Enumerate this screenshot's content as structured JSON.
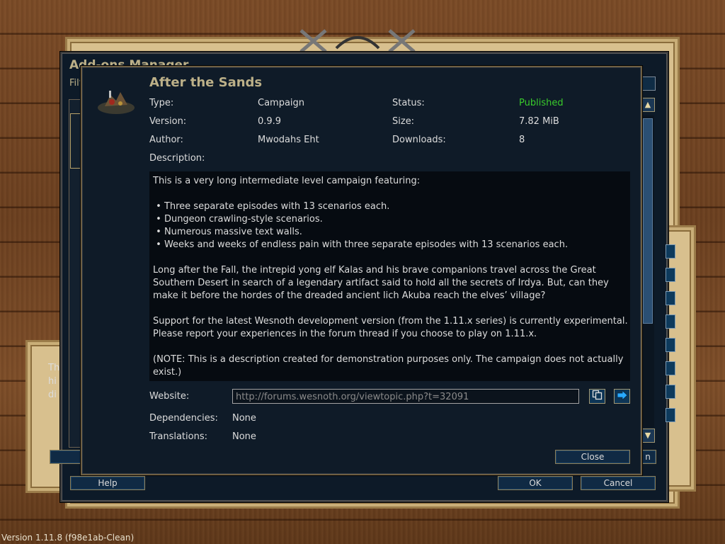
{
  "outer_dialog": {
    "title": "Add-ons Manager",
    "filter_label": "Filt",
    "side_text": "Th\nhi\ndi",
    "buttons": {
      "help": "Help",
      "ok": "OK",
      "cancel": "Cancel"
    },
    "side_button_fragment": "n"
  },
  "addon": {
    "title": "After the Sands",
    "fields": [
      {
        "label": "Type:",
        "value": "Campaign"
      },
      {
        "label": "Version:",
        "value": "0.9.9"
      },
      {
        "label": "Author:",
        "value": "Mwodahs Eht"
      }
    ],
    "fields_right": [
      {
        "label": "Status:",
        "value": "Published"
      },
      {
        "label": "Size:",
        "value": "7.82 MiB"
      },
      {
        "label": "Downloads:",
        "value": "8"
      }
    ],
    "description_label": "Description:",
    "description": "This is a very long intermediate level campaign featuring:\n\n • Three separate episodes with 13 scenarios each.\n • Dungeon crawling-style scenarios.\n • Numerous massive text walls.\n • Weeks and weeks of endless pain with three separate episodes with 13 scenarios each.\n\nLong after the Fall, the intrepid yong elf Kalas and his brave companions travel across the Great Southern Desert in search of a legendary artifact said to hold all the secrets of Irdya. But, can they make it before the hordes of the dreaded ancient lich Akuba reach the elves’ village?\n\nSupport for the latest Wesnoth development version (from the 1.11.x series) is currently experimental. Please report your experiences in the forum thread if you choose to play on 1.11.x.\n\n(NOTE: This is a description created for demonstration purposes only. The campaign does not actually exist.)",
    "website_label": "Website:",
    "website_url": "http://forums.wesnoth.org/viewtopic.php?t=32091",
    "dependencies_label": "Dependencies:",
    "dependencies": "None",
    "translations_label": "Translations:",
    "translations": "None",
    "close_label": "Close",
    "status_color": "#39cc2b",
    "icons": {
      "copy": "copy-icon",
      "go": "arrow-right-icon",
      "addon": "campaign-icon"
    }
  },
  "version_text": "Version 1.11.8 (f98e1ab-Clean)"
}
